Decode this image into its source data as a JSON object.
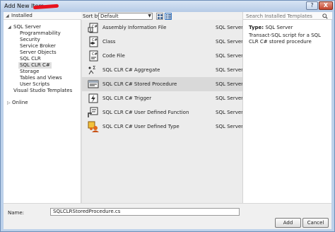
{
  "window": {
    "title": "Add New Item - ",
    "help_glyph": "?",
    "close_glyph": "X"
  },
  "tree": {
    "installed": "Installed",
    "nodes": [
      {
        "label": "SQL Server"
      },
      {
        "label": "Programmability"
      },
      {
        "label": "Security"
      },
      {
        "label": "Service Broker"
      },
      {
        "label": "Server Objects"
      },
      {
        "label": "SQL CLR"
      },
      {
        "label": "SQL CLR C#"
      },
      {
        "label": "Storage"
      },
      {
        "label": "Tables and Views"
      },
      {
        "label": "User Scripts"
      },
      {
        "label": "Visual Studio Templates"
      },
      {
        "label": "Online"
      }
    ],
    "selected": "SQL CLR C#"
  },
  "toolbar": {
    "sort_label": "Sort by:",
    "sort_value": "Default"
  },
  "items": [
    {
      "name": "Assembly Information File",
      "type": "SQL Server",
      "icon": "assembly-info-icon"
    },
    {
      "name": "Class",
      "type": "SQL Server",
      "icon": "csharp-class-icon"
    },
    {
      "name": "Code File",
      "type": "SQL Server",
      "icon": "code-file-icon"
    },
    {
      "name": "SQL CLR C# Aggregate",
      "type": "SQL Server",
      "icon": "aggregate-icon"
    },
    {
      "name": "SQL CLR C# Stored Procedure",
      "type": "SQL Server",
      "icon": "stored-procedure-icon"
    },
    {
      "name": "SQL CLR C# Trigger",
      "type": "SQL Server",
      "icon": "trigger-icon"
    },
    {
      "name": "SQL CLR C# User Defined Function",
      "type": "SQL Server",
      "icon": "function-icon"
    },
    {
      "name": "SQL CLR C# User Defined Type",
      "type": "SQL Server",
      "icon": "user-type-icon"
    }
  ],
  "selected_item": "SQL CLR C# Stored Procedure",
  "detail": {
    "search_placeholder": "Search Installed Templates",
    "type_label": "Type:",
    "type_value": "SQL Server",
    "description": "Transact-SQL script for a SQL CLR C# stored procedure"
  },
  "bottom": {
    "name_label": "Name:",
    "name_value": "SQLCLRStoredProcedure.cs",
    "add_label": "Add",
    "cancel_label": "Cancel"
  }
}
